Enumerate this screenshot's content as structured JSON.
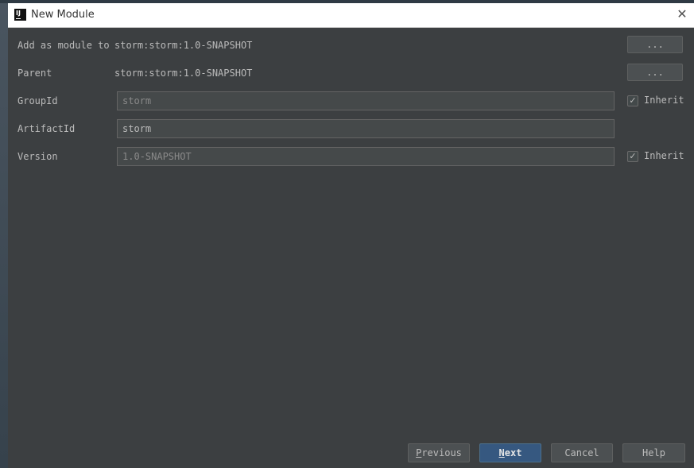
{
  "window": {
    "title": "New Module",
    "icon_text": "IJ",
    "close_label": "✕"
  },
  "form": {
    "add_as_module": {
      "label": "Add as module to",
      "value": "storm:storm:1.0-SNAPSHOT",
      "button": "..."
    },
    "parent": {
      "label": "Parent",
      "value": "storm:storm:1.0-SNAPSHOT",
      "button": "..."
    },
    "group_id": {
      "label": "GroupId",
      "value": "storm",
      "inherit_label": "Inherit",
      "inherit_checked": true
    },
    "artifact_id": {
      "label": "ArtifactId",
      "value": "storm"
    },
    "version": {
      "label": "Version",
      "value": "1.0-SNAPSHOT",
      "inherit_label": "Inherit",
      "inherit_checked": true
    }
  },
  "buttons": {
    "previous": {
      "mnemonic": "P",
      "rest": "revious"
    },
    "next": {
      "mnemonic": "N",
      "rest": "ext"
    },
    "cancel": "Cancel",
    "help": "Help"
  },
  "colors": {
    "background": "#3c3f41",
    "default_button": "#365880",
    "titlebar": "#ffffff"
  }
}
